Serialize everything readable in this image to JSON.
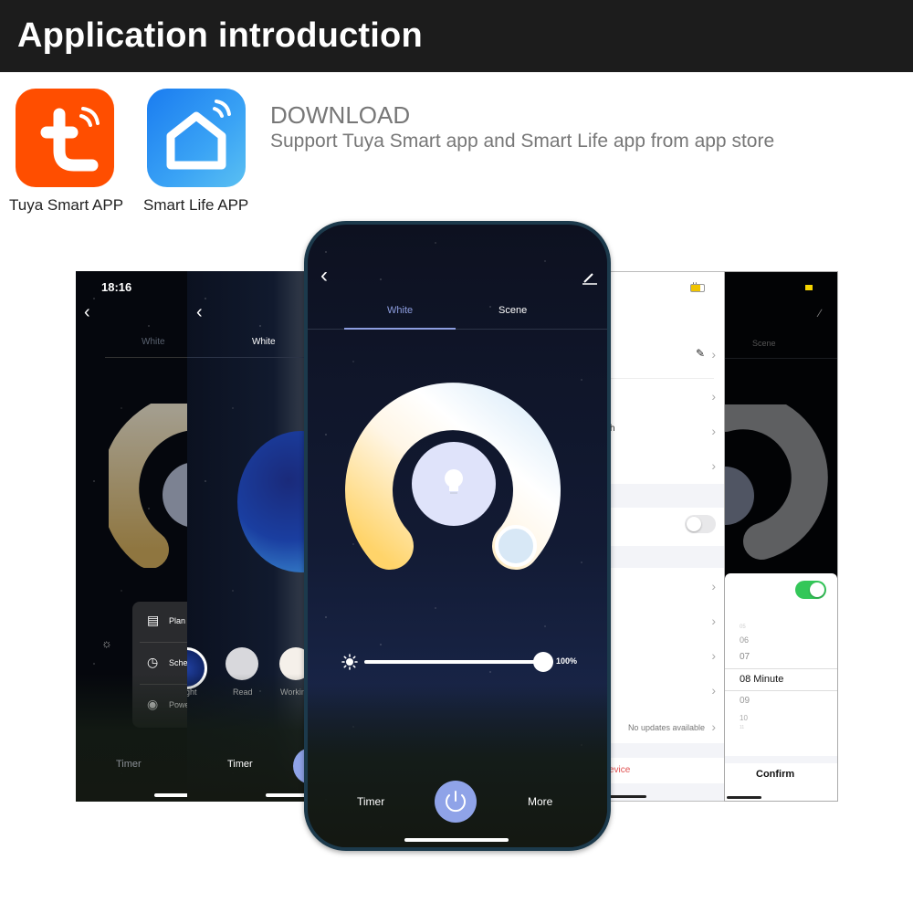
{
  "header": {
    "title": "Application introduction"
  },
  "apps": [
    {
      "name": "Tuya Smart APP",
      "icon": "tuya-logo-icon",
      "color": "#ff4e00"
    },
    {
      "name": "Smart Life APP",
      "icon": "smart-life-house-icon",
      "color": "#2a8ff2"
    }
  ],
  "download": {
    "title": "DOWNLOAD",
    "subtitle": "Support Tuya Smart app and Smart Life app from app store"
  },
  "screen1": {
    "time": "18:16",
    "tab": "White",
    "menu": [
      "Plan",
      "Sche",
      "Powe"
    ],
    "bottom": "Timer"
  },
  "screen2": {
    "tab": "White",
    "scenes": [
      "ght",
      "Read",
      "Workin"
    ],
    "bottom": "Timer"
  },
  "main_phone": {
    "tabs": [
      {
        "label": "White",
        "active": true
      },
      {
        "label": "Scene",
        "active": false
      }
    ],
    "brightness": {
      "value_percent": 100,
      "label": "100%"
    },
    "bottom": {
      "left": "Timer",
      "right": "More"
    },
    "accent": "#8fa3e8"
  },
  "screen4": {
    "rows": [
      "",
      "",
      "h",
      "",
      "",
      "",
      "",
      "",
      "No updates available"
    ],
    "remove": "evice",
    "toggle_on": false
  },
  "screen5": {
    "tab": "Scene",
    "toggle_on": true,
    "picker": {
      "above": [
        "05",
        "06",
        "07"
      ],
      "selected": "08 Minute",
      "below": [
        "09",
        "10",
        "11"
      ]
    },
    "confirm": "Confirm"
  }
}
